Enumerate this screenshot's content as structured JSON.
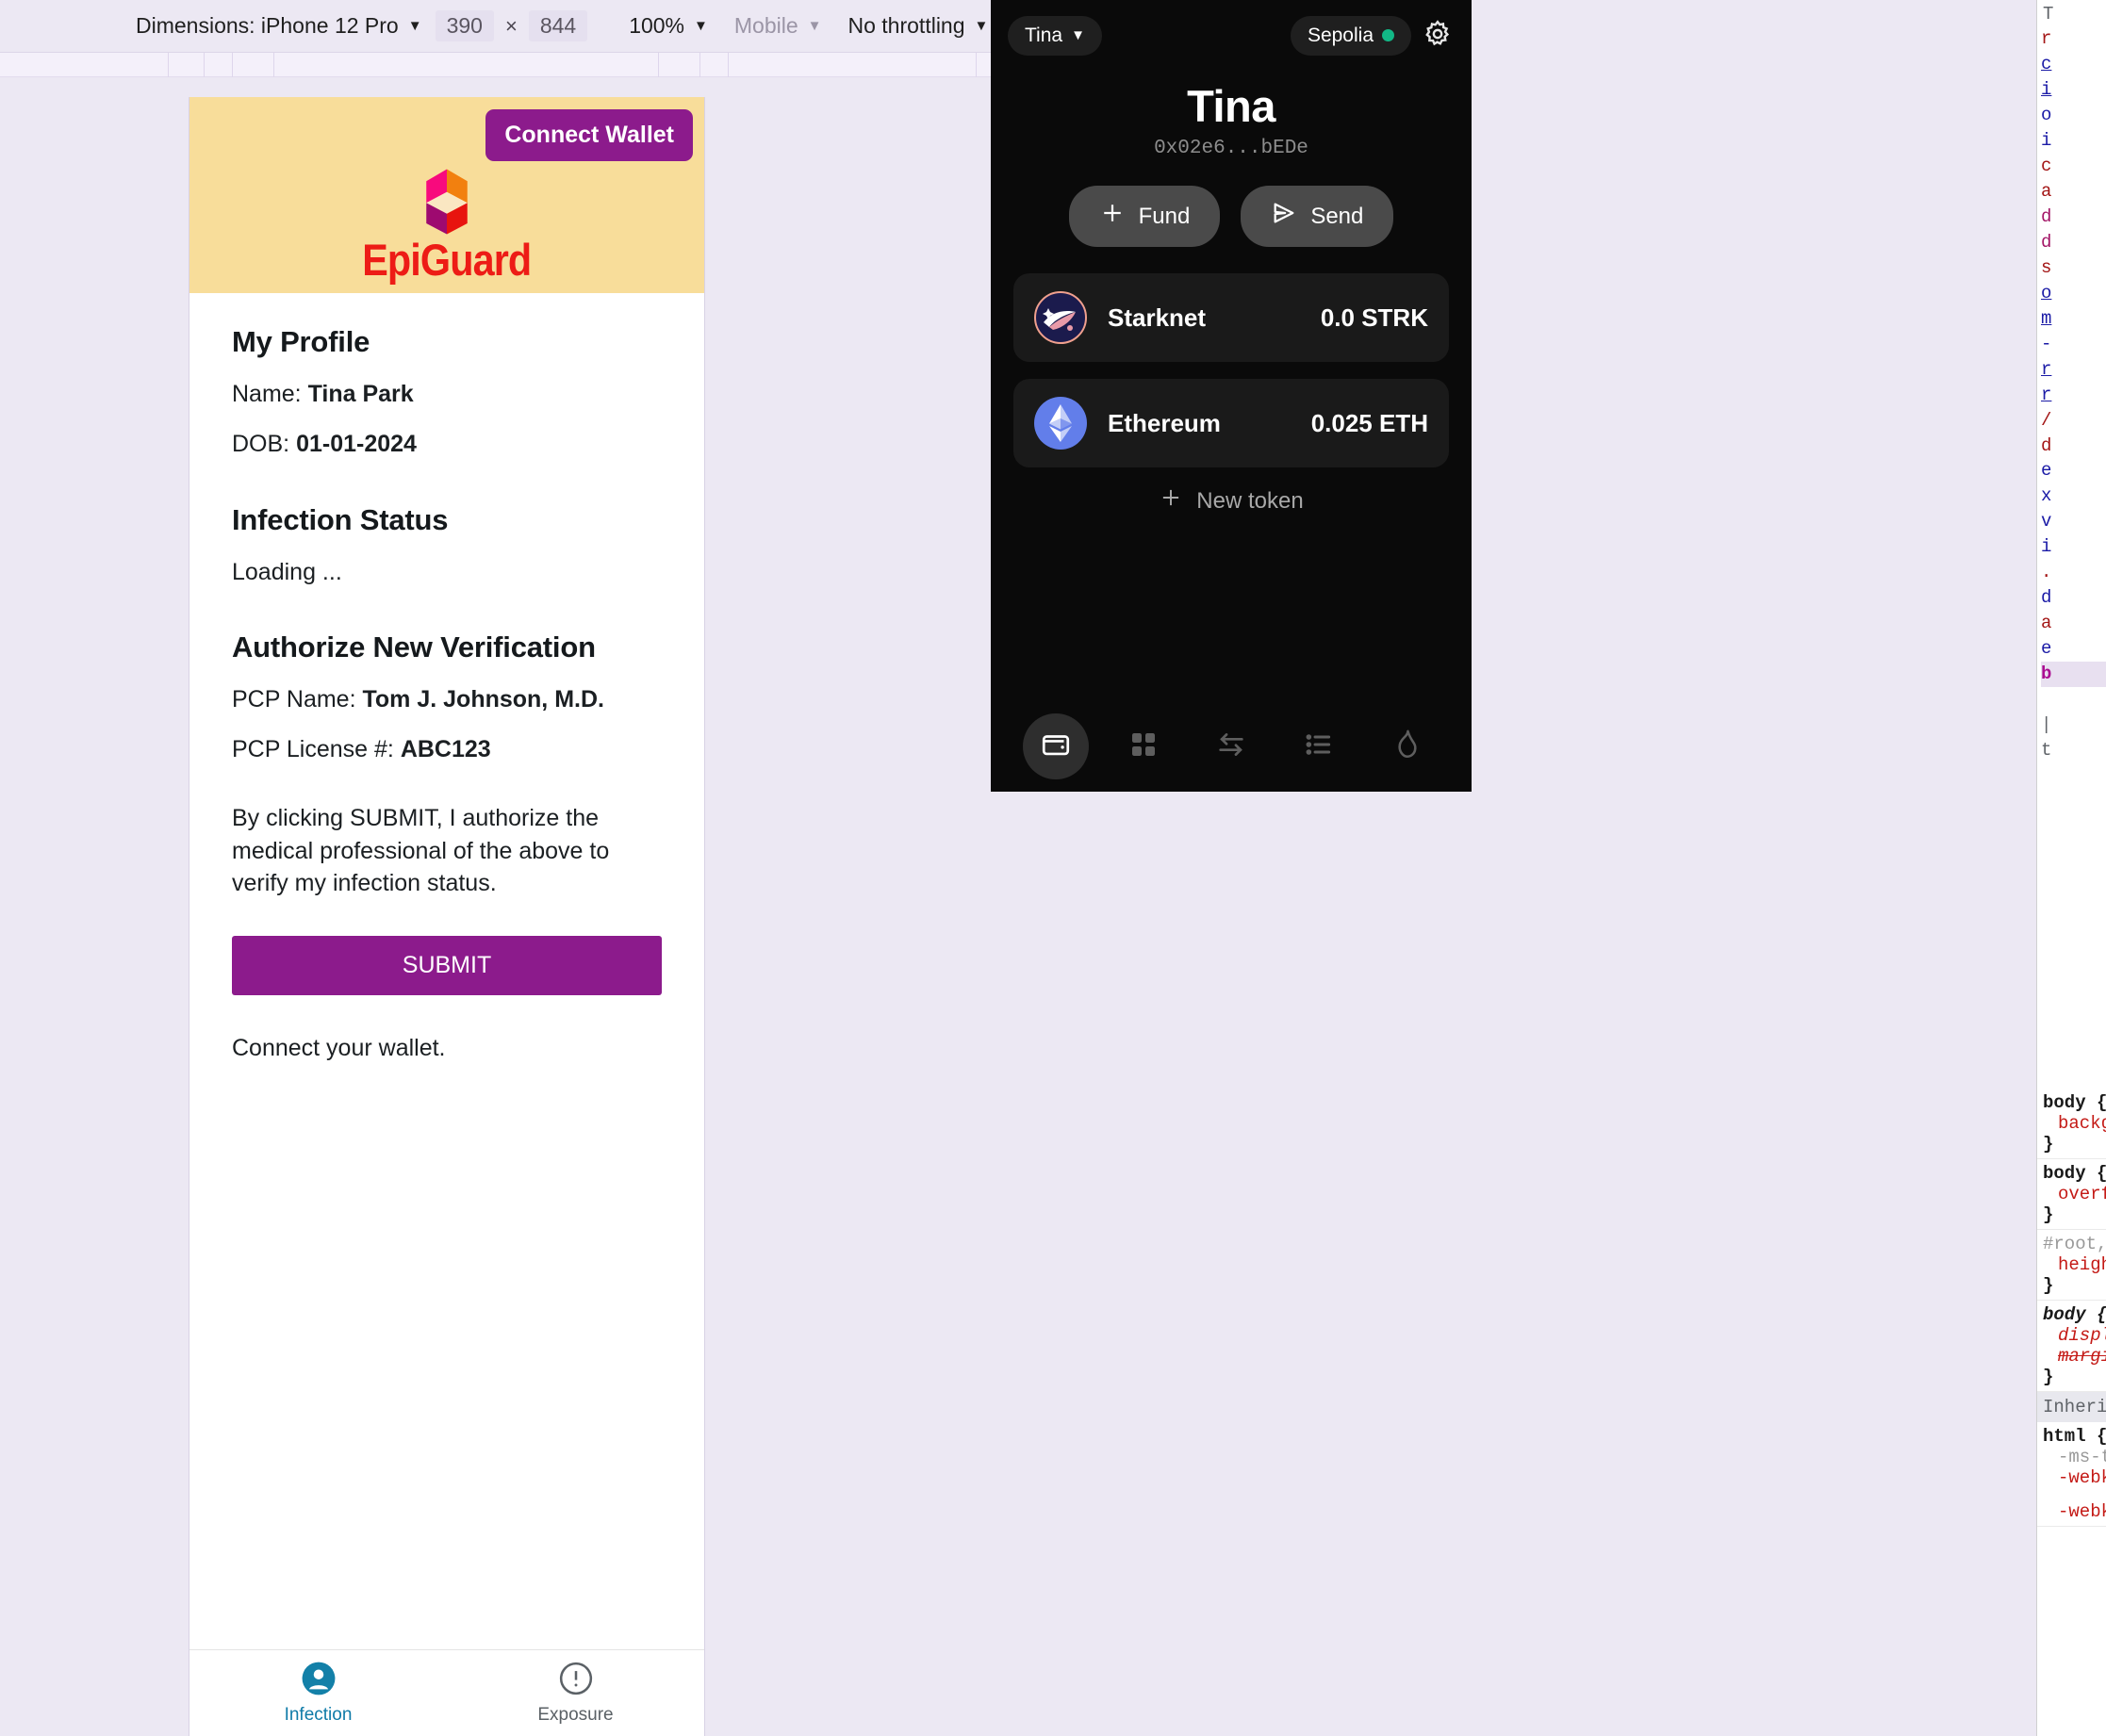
{
  "devtools": {
    "dimensions_label": "Dimensions: iPhone 12 Pro",
    "width_value": "390",
    "multiply": "×",
    "height_value": "844",
    "zoom_value": "100%",
    "device_type": "Mobile",
    "throttling": "No throttling",
    "rotate_icon": "rotate-icon",
    "caret": "▼"
  },
  "app": {
    "connect_wallet_label": "Connect Wallet",
    "logo_text": "EpiGuard",
    "profile": {
      "heading": "My Profile",
      "name_label": "Name:",
      "name_value": "Tina Park",
      "dob_label": "DOB:",
      "dob_value": "01-01-2024"
    },
    "infection": {
      "heading": "Infection Status",
      "status": "Loading ..."
    },
    "authorize": {
      "heading": "Authorize New Verification",
      "pcp_name_label": "PCP Name:",
      "pcp_name_value": "Tom J. Johnson, M.D.",
      "pcp_license_label": "PCP License #:",
      "pcp_license_value": "ABC123",
      "consent_text": "By clicking SUBMIT, I authorize the medical professional of the above to verify my infection status.",
      "submit_label": "SUBMIT",
      "connect_note": "Connect your wallet."
    },
    "tabs": [
      {
        "label": "Infection",
        "icon": "person-icon",
        "active": true
      },
      {
        "label": "Exposure",
        "icon": "alert-circle-icon",
        "active": false
      }
    ]
  },
  "wallet": {
    "account_pill": "Tina",
    "network_pill": "Sepolia",
    "settings_icon": "gear-icon",
    "name": "Tina",
    "address": "0x02e6...bEDe",
    "actions": [
      {
        "label": "Fund",
        "icon": "plus-icon"
      },
      {
        "label": "Send",
        "icon": "send-icon"
      }
    ],
    "tokens": [
      {
        "name": "Starknet",
        "amount": "0.0 STRK",
        "logo": "starknet-logo"
      },
      {
        "name": "Ethereum",
        "amount": "0.025 ETH",
        "logo": "ethereum-logo"
      }
    ],
    "new_token_label": "New token",
    "nav": [
      {
        "icon": "wallet-icon",
        "active": true
      },
      {
        "icon": "grid-icon",
        "active": false
      },
      {
        "icon": "swap-icon",
        "active": false
      },
      {
        "icon": "list-icon",
        "active": false
      },
      {
        "icon": "flame-icon",
        "active": false
      }
    ]
  },
  "styles_pane": {
    "tokens_top": [
      "T",
      "r",
      "c",
      "i",
      "o",
      "i",
      "c",
      "a",
      "d",
      "d",
      "s",
      "o",
      "m",
      "-",
      "r",
      "r",
      "/",
      "d",
      "e",
      "x",
      "v",
      "i",
      ".",
      "d",
      "a",
      "e",
      "b"
    ],
    "rules": [
      {
        "selector": "body {",
        "props": [
          "backg"
        ],
        "close": "}"
      },
      {
        "selector": "body {",
        "props": [
          "overf"
        ],
        "close": "}"
      },
      {
        "selector": "#root, b",
        "props": [
          "heigh"
        ],
        "close": "}",
        "gray": true
      },
      {
        "selector": "body {",
        "props": [
          "displ",
          "margi"
        ],
        "close": "}",
        "italic": true
      }
    ],
    "inherited_label": "Inherited",
    "html_rule": {
      "selector": "html {",
      "props": [
        "-ms-t",
        "-webk",
        "-webk"
      ]
    }
  },
  "colors": {
    "app_header_bg": "#f8dd9a",
    "brand_red": "#ed1c16",
    "purple": "#8c1b8c",
    "tab_active": "#0f7ba8",
    "wallet_bg": "#0a0a0a",
    "network_dot": "#12b886"
  }
}
